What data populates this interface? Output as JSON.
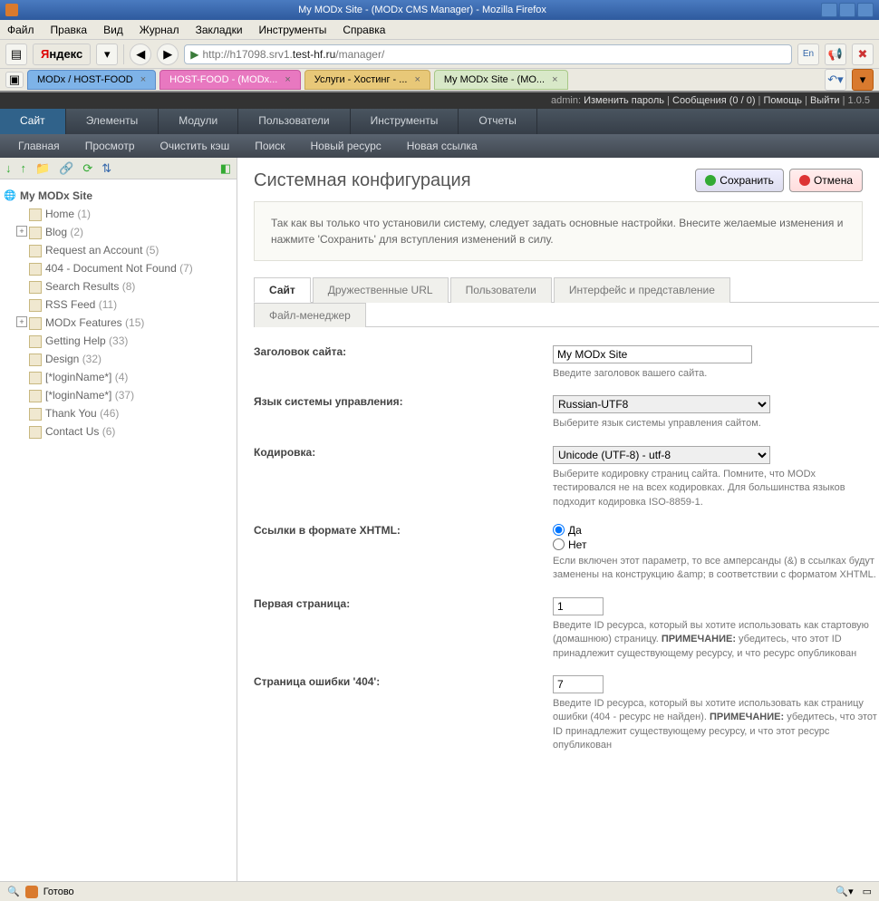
{
  "window": {
    "title": "My MODx Site - (MODx CMS Manager) - Mozilla Firefox"
  },
  "menubar": [
    "Файл",
    "Правка",
    "Вид",
    "Журнал",
    "Закладки",
    "Инструменты",
    "Справка"
  ],
  "url": {
    "prefix": "http://h17098.srv1.",
    "host": "test-hf.ru",
    "path": "/manager/"
  },
  "browser_tabs": [
    {
      "label": "MODx / HOST-FOOD"
    },
    {
      "label": "HOST-FOOD - (MODx..."
    },
    {
      "label": "Услуги - Хостинг - ..."
    },
    {
      "label": "My MODx Site - (MO..."
    }
  ],
  "topbar": {
    "user": "admin",
    "change_pw": "Изменить пароль",
    "messages": "Сообщения (0 / 0)",
    "help": "Помощь",
    "logout": "Выйти",
    "version": "1.0.5"
  },
  "nav": [
    "Сайт",
    "Элементы",
    "Модули",
    "Пользователи",
    "Инструменты",
    "Отчеты"
  ],
  "subnav": [
    "Главная",
    "Просмотр",
    "Очистить кэш",
    "Поиск",
    "Новый ресурс",
    "Новая ссылка"
  ],
  "tree": {
    "root": "My MODx Site",
    "items": [
      {
        "label": "Home",
        "count": "(1)"
      },
      {
        "label": "Blog",
        "count": "(2)",
        "exp": true
      },
      {
        "label": "Request an Account",
        "count": "(5)"
      },
      {
        "label": "404 - Document Not Found",
        "count": "(7)"
      },
      {
        "label": "Search Results",
        "count": "(8)"
      },
      {
        "label": "RSS Feed",
        "count": "(11)"
      },
      {
        "label": "MODx Features",
        "count": "(15)",
        "exp": true
      },
      {
        "label": "Getting Help",
        "count": "(33)"
      },
      {
        "label": "Design",
        "count": "(32)"
      },
      {
        "label": "[*loginName*]",
        "count": "(4)"
      },
      {
        "label": "[*loginName*]",
        "count": "(37)"
      },
      {
        "label": "Thank You",
        "count": "(46)"
      },
      {
        "label": "Contact Us",
        "count": "(6)"
      }
    ]
  },
  "page": {
    "title": "Системная конфигурация",
    "save": "Сохранить",
    "cancel": "Отмена",
    "info": "Так как вы только что установили систему, следует задать основные настройки. Внесите желаемые изменения и нажмите 'Сохранить' для вступления изменений в силу."
  },
  "cfg_tabs": [
    "Сайт",
    "Дружественные URL",
    "Пользователи",
    "Интерфейс и представление",
    "Файл-менеджер"
  ],
  "form": {
    "site_title": {
      "label": "Заголовок сайта:",
      "value": "My MODx Site",
      "help": "Введите заголовок вашего сайта."
    },
    "lang": {
      "label": "Язык системы управления:",
      "value": "Russian-UTF8",
      "help": "Выберите язык системы управления сайтом."
    },
    "enc": {
      "label": "Кодировка:",
      "value": "Unicode (UTF-8) - utf-8",
      "help": "Выберите кодировку страниц сайта. Помните, что MODx тестировался не на всех кодировках. Для большинства языков подходит кодировка ISO-8859-1."
    },
    "xhtml": {
      "label": "Ссылки в формате XHTML:",
      "yes": "Да",
      "no": "Нет",
      "help": "Если включен этот параметр, то все амперсанды (&) в ссылках будут заменены на конструкцию &amp; в соответствии с форматом XHTML."
    },
    "start": {
      "label": "Первая страница:",
      "value": "1",
      "help1": "Введите ID ресурса, который вы хотите использовать как стартовую (домашнюю) страницу. ",
      "note": "ПРИМЕЧАНИЕ:",
      "help2": " убедитесь, что этот ID принадлежит существующему ресурсу, и что ресурс опубликован"
    },
    "err": {
      "label": "Страница ошибки '404':",
      "value": "7",
      "help1": "Введите ID ресурса, который вы хотите использовать как страницу ошибки (404 - ресурс не найден). ",
      "note": "ПРИМЕЧАНИЕ:",
      "help2": " убедитесь, что этот ID принадлежит существующему ресурсу, и что этот ресурс опубликован"
    }
  },
  "status": "Готово"
}
